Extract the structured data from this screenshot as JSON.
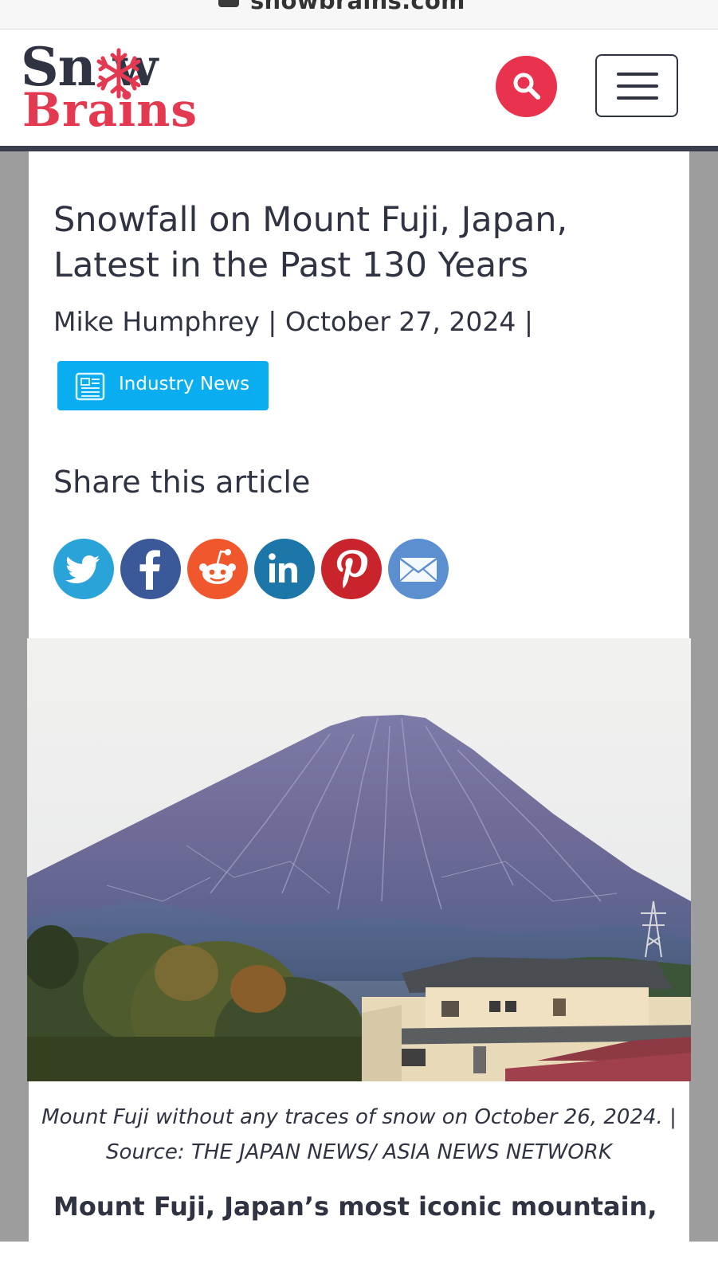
{
  "browser": {
    "url": "snowbrains.com"
  },
  "header": {
    "logo_top": "Sn  w",
    "logo_bottom": "Brains",
    "logo_alt": "SnowBrains",
    "colors": {
      "dark": "#2f3342",
      "brand_red": "#e33a52",
      "search_bg": "#e8324e"
    }
  },
  "article": {
    "title": "Snowfall on Mount Fuji, Japan, Latest in the Past 130 Years",
    "byline": "Mike Humphrey | October 27, 2024 |",
    "category": "Industry News",
    "category_color": "#0aaef0",
    "share_heading": "Share this article",
    "share_buttons": [
      {
        "name": "twitter",
        "icon": "twitter-icon",
        "color": "#2aa3d8"
      },
      {
        "name": "facebook",
        "icon": "facebook-icon",
        "color": "#3b5998"
      },
      {
        "name": "reddit",
        "icon": "reddit-icon",
        "color": "#f0572c"
      },
      {
        "name": "linkedin",
        "icon": "linkedin-icon",
        "color": "#1c76a8"
      },
      {
        "name": "pinterest",
        "icon": "pinterest-icon",
        "color": "#c9242c"
      },
      {
        "name": "email",
        "icon": "email-icon",
        "color": "#5b8fd0"
      }
    ],
    "image_caption": "Mount Fuji without any traces of snow on October 26, 2024. | Source: THE JAPAN NEWS/ ASIA NEWS NETWORK",
    "lead_text": "Mount Fuji, Japan’s most iconic mountain,"
  }
}
